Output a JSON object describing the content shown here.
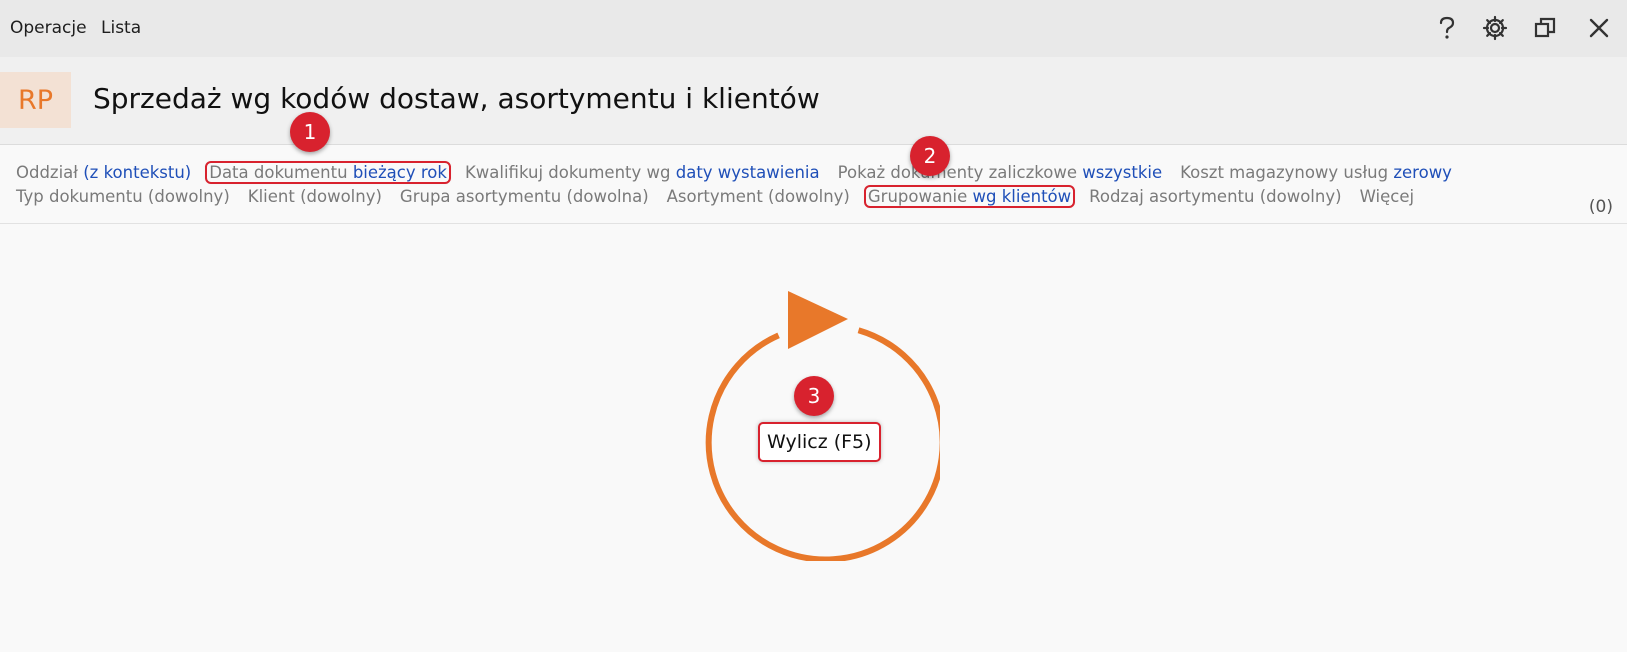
{
  "menu": {
    "items": [
      "Operacje",
      "Lista"
    ]
  },
  "window_controls": [
    "help-icon",
    "gear-icon",
    "restore-icon",
    "close-icon"
  ],
  "header": {
    "badge": "RP",
    "title": "Sprzedaż wg kodów dostaw, asortymentu i klientów"
  },
  "filters": {
    "row1": [
      {
        "label": "Oddział",
        "value": "(z kontekstu)"
      },
      {
        "label": "Data dokumentu",
        "value": "bieżący rok"
      },
      {
        "label": "Kwalifikuj dokumenty wg",
        "value": "daty wystawienia"
      },
      {
        "label": "Pokaż dokumenty zaliczkowe",
        "value": "wszystkie"
      },
      {
        "label": "Koszt magazynowy usług",
        "value": "zerowy"
      }
    ],
    "row2": [
      {
        "label": "Typ dokumentu (dowolny)",
        "value": ""
      },
      {
        "label": "Klient (dowolny)",
        "value": ""
      },
      {
        "label": "Grupa asortymentu (dowolna)",
        "value": ""
      },
      {
        "label": "Asortyment (dowolny)",
        "value": ""
      },
      {
        "label": "Grupowanie",
        "value": "wg klientów"
      },
      {
        "label": "Rodzaj asortymentu (dowolny)",
        "value": ""
      },
      {
        "label": "Więcej",
        "value": ""
      }
    ],
    "count": "(0)"
  },
  "main": {
    "calc_label": "Wylicz (F5)"
  },
  "markers": [
    "1",
    "2",
    "3"
  ],
  "colors": {
    "accent": "#e8782a",
    "link": "#1f4fb8",
    "highlight": "#d8222e"
  }
}
